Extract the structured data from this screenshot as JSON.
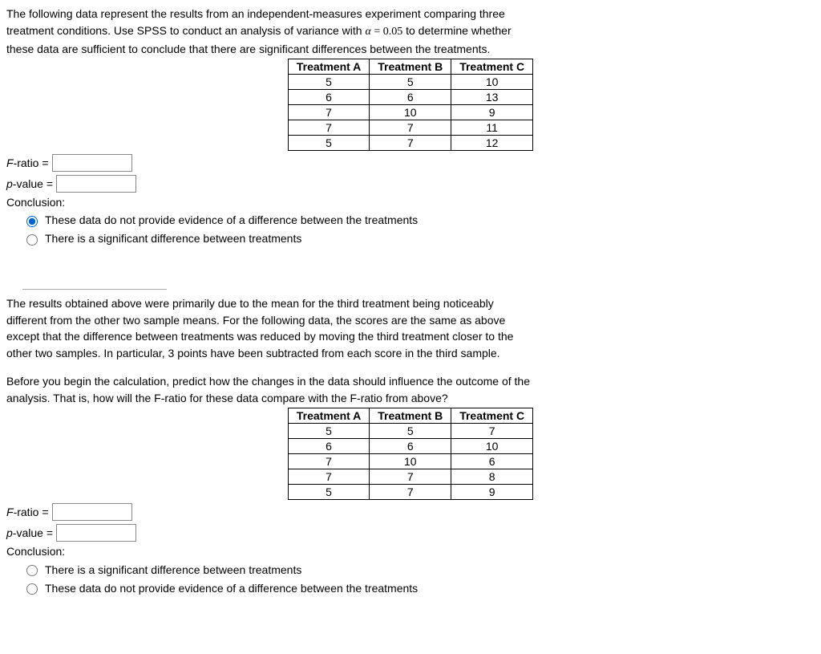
{
  "section1": {
    "prompt_line1": "The following data represent the results from an independent-measures experiment comparing three",
    "prompt_line2a": "treatment conditions. Use SPSS to conduct an analysis of variance with ",
    "prompt_alpha_var": "α",
    "prompt_eq": " = ",
    "prompt_alpha_val": "0.05",
    "prompt_line2b": " to determine whether",
    "prompt_line3": "these data are sufficient to conclude that there are significant differences between the treatments.",
    "table": {
      "headers": [
        "Treatment A",
        "Treatment B",
        "Treatment C"
      ],
      "rows": [
        [
          "5",
          "5",
          "10"
        ],
        [
          "6",
          "6",
          "13"
        ],
        [
          "7",
          "10",
          "9"
        ],
        [
          "7",
          "7",
          "11"
        ],
        [
          "5",
          "7",
          "12"
        ]
      ]
    },
    "f_ratio_label": "F-ratio = ",
    "p_value_label": "p-value = ",
    "conclusion_label": "Conclusion:",
    "option1": "These data do not provide evidence of a difference between the treatments",
    "option2": "There is a significant difference between treatments",
    "selected": 0
  },
  "section2": {
    "prompt_para1_line1": "The results obtained above were primarily due to the mean for the third treatment being noticeably",
    "prompt_para1_line2": "different from the other two sample means. For the following data, the scores are the same as above",
    "prompt_para1_line3": "except that the difference between treatments was reduced by moving the third treatment closer to the",
    "prompt_para1_line4": "other two samples. In particular, 3 points have been subtracted from each score in the third sample.",
    "prompt_para2_line1": "Before you begin the calculation, predict how the changes in the data should influence the outcome of the",
    "prompt_para2_line2a": "analysis. That is, how will the ",
    "prompt_para2_fratio1": "F-ratio",
    "prompt_para2_line2b": " for these data compare with the ",
    "prompt_para2_fratio2": "F-ratio",
    "prompt_para2_line2c": " from above?",
    "table": {
      "headers": [
        "Treatment A",
        "Treatment B",
        "Treatment C"
      ],
      "rows": [
        [
          "5",
          "5",
          "7"
        ],
        [
          "6",
          "6",
          "10"
        ],
        [
          "7",
          "10",
          "6"
        ],
        [
          "7",
          "7",
          "8"
        ],
        [
          "5",
          "7",
          "9"
        ]
      ]
    },
    "f_ratio_label": "F-ratio = ",
    "p_value_label": "p-value = ",
    "conclusion_label": "Conclusion:",
    "option1": "There is a significant difference between treatments",
    "option2": "These data do not provide evidence of a difference between the treatments",
    "selected": -1
  }
}
